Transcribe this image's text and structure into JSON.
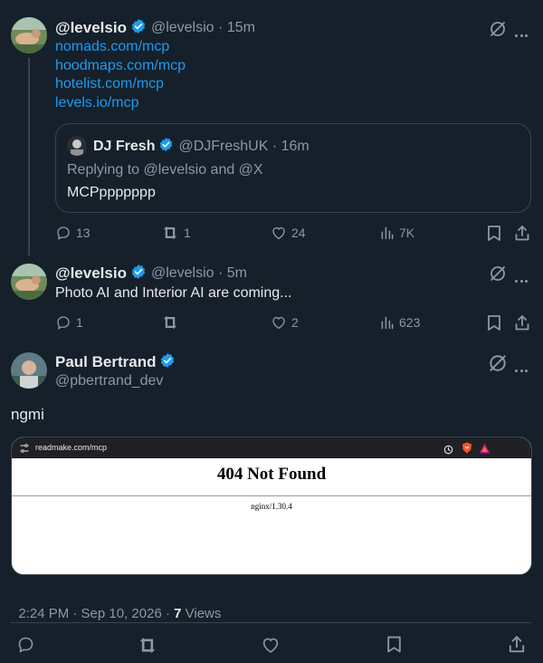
{
  "tweet1": {
    "name": "@levelsio",
    "handle": "@levelsio",
    "time": "15m",
    "links": [
      "nomads.com/mcp",
      "hoodmaps.com/mcp",
      "hotelist.com/mcp",
      "levels.io/mcp"
    ],
    "quote": {
      "name": "DJ Fresh",
      "handle": "@DJFreshUK",
      "time": "16m",
      "replying": "Replying to @levelsio and @X",
      "text": "MCPppppppp"
    },
    "stats": {
      "replies": "13",
      "reposts": "1",
      "likes": "24",
      "views": "7K"
    }
  },
  "tweet2": {
    "name": "@levelsio",
    "handle": "@levelsio",
    "time": "5m",
    "text": "Photo AI and Interior AI are coming...",
    "stats": {
      "replies": "1",
      "reposts": "",
      "likes": "2",
      "views": "623"
    }
  },
  "main": {
    "name": "Paul Bertrand",
    "handle": "@pbertrand_dev",
    "text": "ngmi",
    "browser": {
      "url": "readmake.com/mcp",
      "heading": "404 Not Found",
      "server": "nginx/1.30.4"
    },
    "timestamp": "2:24 PM · Sep 10, 2026 · ",
    "views_count": "7",
    "views_label": " Views"
  },
  "separator": " · ",
  "colors": {
    "background": "#15202b",
    "accent": "#1d9bf0",
    "muted": "#8b98a5",
    "border": "#38444d"
  }
}
